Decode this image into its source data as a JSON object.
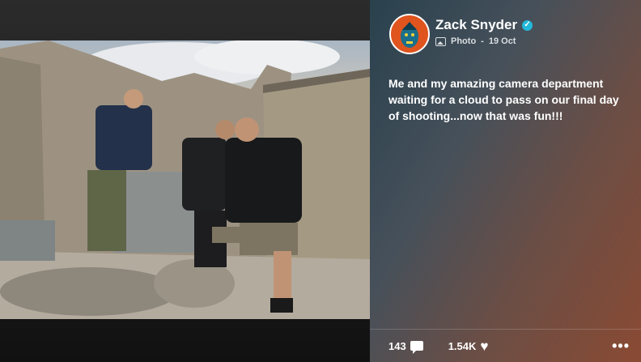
{
  "post": {
    "author": "Zack Snyder",
    "verified_icon": "verified-check-icon",
    "media_type": "Photo",
    "date": "19 Oct",
    "caption": "Me and my amazing camera department waiting for a cloud to pass on our final day of shooting...now that was fun!!!"
  },
  "footer": {
    "comments": "143",
    "likes": "1.54K",
    "more": "•••"
  },
  "colors": {
    "verified": "#22b8d9",
    "avatar_bg": "#e0541e"
  }
}
